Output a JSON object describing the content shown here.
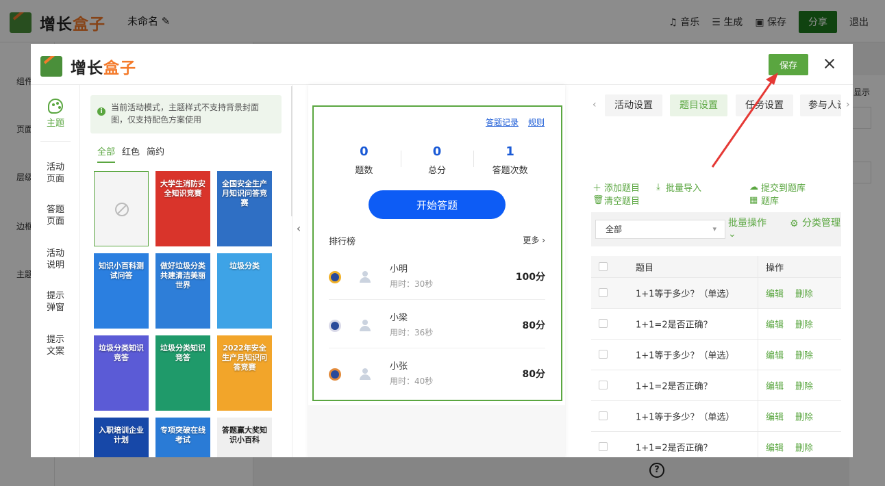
{
  "app": {
    "logo_main": "增长",
    "logo_accent": "盒子",
    "doc_title": "未命名",
    "actions": {
      "music": "音乐",
      "generate": "生成",
      "save": "保存",
      "share": "分享",
      "exit": "退出"
    },
    "left_nav": [
      "组件",
      "页面",
      "层级",
      "边框",
      "主题"
    ],
    "right_label": "显示"
  },
  "modal": {
    "logo_main": "增长",
    "logo_accent": "盒子",
    "save_label": "保存",
    "vtabs": [
      "主题",
      "活动\n页面",
      "答题\n页面",
      "活动\n说明",
      "提示\n弹窗",
      "提示\n文案"
    ],
    "notice": "当前活动模式，主题样式不支持背景封面图，仅支持配色方案使用",
    "filter_tabs": [
      "全部",
      "红色",
      "简约"
    ],
    "themes": [
      {
        "title": "",
        "color": "#f4f4f4"
      },
      {
        "title": "大学生消防安全知识竞赛",
        "color": "#d9342b"
      },
      {
        "title": "全国安全生产月知识问答竞赛",
        "color": "#2f6fc4"
      },
      {
        "title": "知识小百科测试问答",
        "color": "#2b7fe0"
      },
      {
        "title": "做好垃圾分类共建清洁美丽世界",
        "color": "#2e7ed8"
      },
      {
        "title": "垃圾分类",
        "color": "#3ea3e6"
      },
      {
        "title": "垃圾分类知识竞答",
        "color": "#5b5bd6"
      },
      {
        "title": "垃圾分类知识竞答",
        "color": "#1f9a6a"
      },
      {
        "title": "2022年安全生产月知识问答竞赛",
        "color": "#f2a52a"
      },
      {
        "title": "入职培训企业计划",
        "color": "#1748a8"
      },
      {
        "title": "专项突破在线考试",
        "color": "#2a7bd6"
      },
      {
        "title": "答题赢大奖知识小百科",
        "color": "#efefef"
      }
    ]
  },
  "preview": {
    "record_link": "答题记录",
    "rules_link": "规则",
    "stats": [
      {
        "value": "0",
        "label": "题数"
      },
      {
        "value": "0",
        "label": "总分"
      },
      {
        "value": "1",
        "label": "答题次数"
      }
    ],
    "start_button": "开始答题",
    "rank_title": "排行榜",
    "more": "更多",
    "ranking": [
      {
        "name": "小明",
        "time": "用时：30秒",
        "score": "100分"
      },
      {
        "name": "小梁",
        "time": "用时：36秒",
        "score": "80分"
      },
      {
        "name": "小张",
        "time": "用时：40秒",
        "score": "80分"
      }
    ]
  },
  "settings": {
    "tabs": [
      "活动设置",
      "题目设置",
      "任务设置",
      "参与人设"
    ],
    "tools": {
      "add": "添加题目",
      "import": "批量导入",
      "submit": "提交到题库",
      "clear": "清空题目",
      "bank": "题库"
    },
    "filter_value": "全部",
    "batch_ops": "批量操作",
    "category_mgmt": "分类管理",
    "table": {
      "headers": {
        "title": "题目",
        "ops": "操作"
      },
      "edit": "编辑",
      "delete": "删除",
      "rows": [
        "1+1等于多少？（单选）",
        "1+1=2是否正确？",
        "1+1等于多少？（单选）",
        "1+1=2是否正确？",
        "1+1等于多少？（单选）",
        "1+1=2是否正确？"
      ]
    }
  },
  "colors": {
    "accent": "#5aa640",
    "primary_blue": "#0d5cf5",
    "annotation": "#e53935"
  }
}
